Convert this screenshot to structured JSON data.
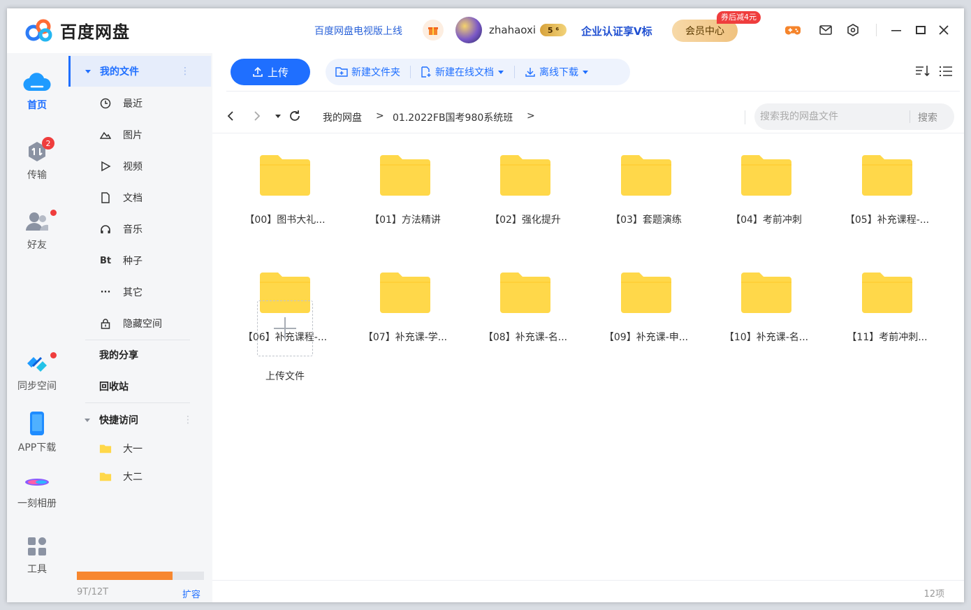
{
  "app": {
    "name": "百度网盘"
  },
  "titlebar": {
    "tv_link": "百度网盘电视版上线",
    "username": "zhahaoxi",
    "vip_badge": "5 ⁶",
    "enterprise": "企业认证享V标",
    "member_center": "会员中心",
    "coupon": "券后减4元"
  },
  "rail": {
    "items": [
      {
        "label": "首页",
        "icon": "cloud-icon"
      },
      {
        "label": "传输",
        "icon": "transfer-icon",
        "badge": "2"
      },
      {
        "label": "好友",
        "icon": "friends-icon"
      },
      {
        "label": "同步空间",
        "icon": "sync-icon"
      },
      {
        "label": "APP下载",
        "icon": "phone-icon"
      },
      {
        "label": "一刻相册",
        "icon": "album-icon"
      },
      {
        "label": "工具",
        "icon": "tools-icon"
      }
    ]
  },
  "sidenav": {
    "my_files": "我的文件",
    "items": [
      {
        "label": "最近",
        "icon": "clock-icon"
      },
      {
        "label": "图片",
        "icon": "image-icon"
      },
      {
        "label": "视频",
        "icon": "video-icon"
      },
      {
        "label": "文档",
        "icon": "document-icon"
      },
      {
        "label": "音乐",
        "icon": "headphones-icon"
      },
      {
        "label": "种子",
        "icon": "bt-icon",
        "glyph": "Bt"
      },
      {
        "label": "其它",
        "icon": "more-icon",
        "glyph": "···"
      },
      {
        "label": "隐藏空间",
        "icon": "lock-icon"
      }
    ],
    "my_share": "我的分享",
    "recycle": "回收站",
    "quick_access": "快捷访问",
    "quick_items": [
      {
        "label": "大一"
      },
      {
        "label": "大二"
      }
    ],
    "storage": {
      "text": "9T/12T",
      "used_fraction": 0.75,
      "expand": "扩容"
    }
  },
  "toolbar": {
    "upload": "上传",
    "new_folder": "新建文件夹",
    "new_doc": "新建在线文档",
    "offline_download": "离线下载"
  },
  "breadcrumb": {
    "root": "我的网盘",
    "sep": ">",
    "current": "01.2022FB国考980系统班",
    "trail": ">"
  },
  "search": {
    "placeholder": "搜索我的网盘文件",
    "button": "搜索"
  },
  "folders": [
    "【00】图书大礼...",
    "【01】方法精讲",
    "【02】强化提升",
    "【03】套题演练",
    "【04】考前冲刺",
    "【05】补充课程-...",
    "【06】补充课程-...",
    "【07】补充课-学...",
    "【08】补充课-名...",
    "【09】补充课-申...",
    "【10】补充课-名...",
    "【11】考前冲刺..."
  ],
  "upload_tile": "上传文件",
  "status": {
    "count": "12项"
  },
  "colors": {
    "accent": "#1f6fff",
    "folder": "#ffd84a",
    "storage": "#f7872f"
  }
}
